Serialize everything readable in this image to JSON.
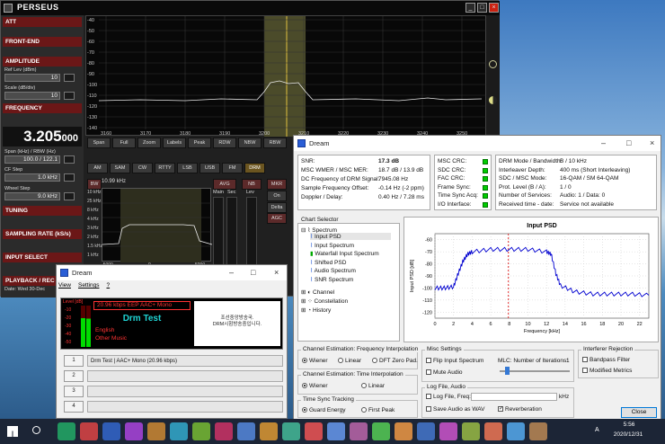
{
  "perseus": {
    "title": "PERSEUS",
    "left_panel": {
      "att": "ATT",
      "frontend": "FRONT-END",
      "amplitude": "AMPLITUDE",
      "ref_lev_label": "Ref Lev (dBm)",
      "ref_lev_value": "10",
      "scale_label": "Scale (dB/div)",
      "scale_value": "10",
      "frequency": "FREQUENCY",
      "freq_main": "3.205",
      "freq_sub": "000",
      "span_label": "Span (kHz) / RBW (Hz)",
      "span_value": "100.0 / 122.1",
      "cf_step_label": "CF Step",
      "cf_step_value": "1.0 kHz",
      "wheel_step_label": "Wheel Step",
      "wheel_step_value": "9.0 kHz",
      "tuning": "TUNING",
      "sampling": "SAMPLING RATE (kS/s)",
      "input_select": "INPUT SELECT",
      "playback": "PLAYBACK / REC",
      "date": "Date: Wed 30-Dec"
    },
    "spectrum": {
      "y_ticks": [
        "-40",
        "-50",
        "-60",
        "-70",
        "-80",
        "-90",
        "-100",
        "-110",
        "-120",
        "-130",
        "-140"
      ],
      "x_ticks": [
        "3160",
        "3170",
        "3180",
        "3190",
        "3200",
        "3210",
        "3220",
        "3230",
        "3240",
        "3250"
      ]
    },
    "controls": {
      "row1": [
        "Span",
        "Full",
        "Zoom",
        "Labels",
        "Peak",
        "RDW",
        "NBW",
        "RBW"
      ],
      "modes": [
        "AM",
        "SAM",
        "CW",
        "RTTY",
        "LSB",
        "USB",
        "FM",
        "DRM"
      ],
      "bw": "BW",
      "bw_value": "10.99 kHz",
      "bw_list": [
        "10 kHz",
        "25 kHz",
        "8 kHz",
        "4 kHz",
        "3 kHz",
        "2 kHz",
        "1.5 kHz",
        "1 kHz"
      ],
      "zoom_ticks": [
        "-5000",
        "0",
        "5000"
      ],
      "avg": "AVG",
      "main": "Main",
      "sec": "Sec",
      "nb": "NB",
      "lev": "Lev",
      "mkr": "MKR",
      "on": "On",
      "delta": "Delta",
      "agc": "AGC"
    }
  },
  "dream": {
    "title": "Dream",
    "status": [
      {
        "label": "SNR:",
        "value": "17.3 dB"
      },
      {
        "label": "MSC WMER / MSC MER:",
        "value": "18.7 dB / 13.9 dB"
      },
      {
        "label": "DC Frequency of DRM Signal:",
        "value": "7945.08 Hz"
      },
      {
        "label": "Sample Frequency Offset:",
        "value": "-0.14 Hz (-2 ppm)"
      },
      {
        "label": "Doppler / Delay:",
        "value": "0.40 Hz / 7.28 ms"
      }
    ],
    "crc": [
      "MSC CRC:",
      "SDC CRC:",
      "FAC CRC:",
      "Frame Sync:",
      "Time Sync Acq:",
      "I/O Interface:"
    ],
    "info": [
      {
        "label": "DRM Mode / Bandwidth:",
        "value": "B / 10 kHz"
      },
      {
        "label": "Interleaver Depth:",
        "value": "400 ms (Short Interleaving)"
      },
      {
        "label": "SDC / MSC Mode:",
        "value": "16-QAM / SM 64-QAM"
      },
      {
        "label": "Prot. Level (B / A):",
        "value": "1 / 0"
      },
      {
        "label": "Number of Services:",
        "value": "Audio: 1 / Data: 0"
      },
      {
        "label": "Received time - date:",
        "value": "Service not available"
      }
    ],
    "chart_selector": "Chart Selector",
    "tree": {
      "spectrum": "Spectrum",
      "children": [
        "Input PSD",
        "Input Spectrum",
        "Waterfall Input Spectrum",
        "Shifted PSD",
        "Audio Spectrum",
        "SNR Spectrum"
      ],
      "channel": "Channel",
      "constellation": "Constellation",
      "history": "History"
    },
    "psd_title": "Input PSD",
    "psd_ylabel": "Input PSD [dB]",
    "psd_xlabel": "Frequency [kHz]",
    "chan_freq": {
      "title": "Channel Estimation: Frequency Interpolation",
      "opts": [
        "Wiener",
        "Linear",
        "DFT Zero Pad."
      ]
    },
    "chan_time": {
      "title": "Channel Estimation: Time Interpolation",
      "opts": [
        "Wiener",
        "Linear"
      ]
    },
    "time_sync": {
      "title": "Time Sync Tracking",
      "opts": [
        "Guard Energy",
        "First Peak"
      ]
    },
    "misc": {
      "title": "Misc Settings",
      "flip": "Flip Input Spectrum",
      "mute": "Mute Audio",
      "mlc": "MLC: Number of Iterations:",
      "mlc_val": "1"
    },
    "logfile": {
      "title": "Log File, Audio",
      "log": "Log File, Freq:",
      "unit": "kHz",
      "save": "Save Audio as WAV",
      "reverb": "Reverberation"
    },
    "interf": {
      "title": "Interferer Rejection",
      "bp": "Bandpass Filter",
      "mm": "Modified Metrics"
    },
    "close": "Close"
  },
  "small_dream": {
    "title": "Dream",
    "menu": [
      "View",
      "Settings",
      "?"
    ],
    "level": "Level [dB]",
    "level_ticks": [
      "-10",
      "-20",
      "-30",
      "-40",
      "-50"
    ],
    "bitrate": "20.96 kbps EEP  AAC+  Mono",
    "station": "Drm Test",
    "lang": "English",
    "genre": "Other Music",
    "text_msg": "조선중앙방송국.\nDRM시험방송중입니다.",
    "services": [
      {
        "num": "1",
        "text": "Drm Test  |  AAC+ Mono (20.96 kbps)"
      },
      {
        "num": "2",
        "text": ""
      },
      {
        "num": "3",
        "text": ""
      },
      {
        "num": "4",
        "text": ""
      }
    ]
  },
  "taskbar": {
    "time": "5:56",
    "date": "2020/12/31",
    "lang": "A"
  },
  "chart_data": [
    {
      "type": "line",
      "title": "Input PSD",
      "xlabel": "Frequency [kHz]",
      "ylabel": "Input PSD [dB]",
      "x_ticks": [
        "0",
        "2",
        "4",
        "6",
        "8",
        "10",
        "12",
        "14",
        "16",
        "18",
        "20",
        "22"
      ],
      "y_ticks": [
        "-60",
        "-70",
        "-80",
        "-90",
        "-100",
        "-110",
        "-120"
      ],
      "xlim": [
        0,
        23
      ],
      "ylim": [
        -125,
        -55
      ],
      "series": [
        {
          "x": [
            0,
            1,
            2,
            2.5,
            3,
            3.5,
            4,
            6,
            8,
            10,
            12,
            12.5,
            13,
            13.5,
            15,
            17,
            19,
            21,
            23
          ],
          "y": [
            -100,
            -100,
            -99,
            -88,
            -78,
            -72,
            -70,
            -68,
            -68,
            -68,
            -70,
            -72,
            -88,
            -98,
            -103,
            -105,
            -105,
            -105,
            -106
          ]
        }
      ],
      "marker_x": [
        7.9
      ]
    }
  ]
}
